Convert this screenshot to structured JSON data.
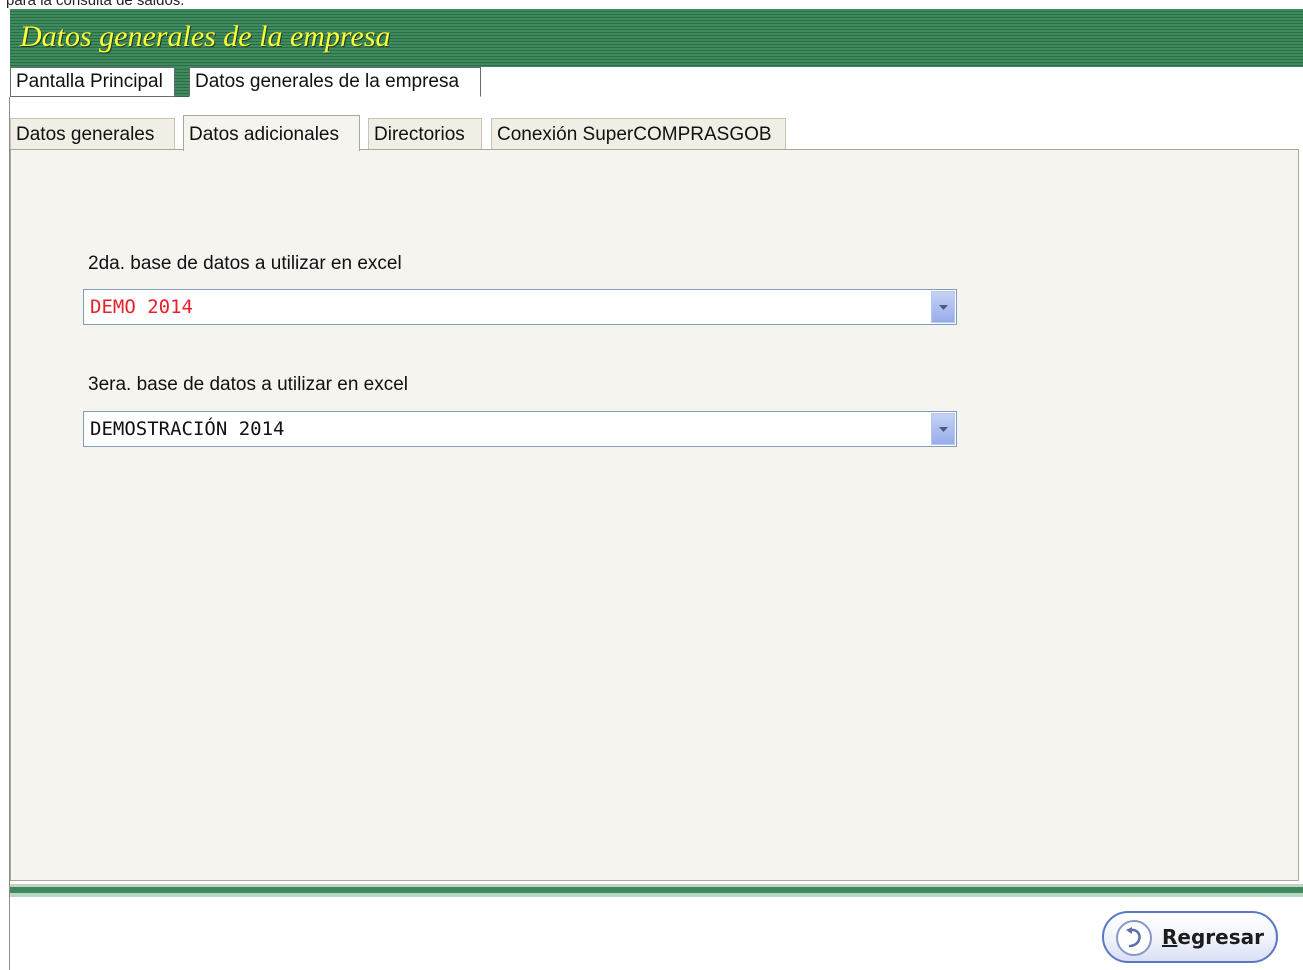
{
  "cut_text": "para la consulta de saldos.",
  "window": {
    "title": "Datos generales de la empresa"
  },
  "main_tabs": [
    {
      "label": "Pantalla Principal"
    },
    {
      "label": "Datos generales de la empresa"
    }
  ],
  "sub_tabs": [
    {
      "label": "Datos generales"
    },
    {
      "label": "Datos adicionales"
    },
    {
      "label": "Directorios"
    },
    {
      "label": "Conexión SuperCOMPRASGOB"
    }
  ],
  "fields": [
    {
      "label": "2da. base de datos a utilizar en excel",
      "value": "DEMO 2014",
      "value_color": "#e8202a"
    },
    {
      "label": "3era. base de datos a utilizar en excel",
      "value": "DEMOSTRACIÓN 2014",
      "value_color": "#111111"
    }
  ],
  "buttons": {
    "back_accel": "R",
    "back_rest": "egresar",
    "back_icon": "undo-arrow-icon"
  },
  "colors": {
    "title_text": "#ffff3a",
    "title_bar": "#3f8a5f",
    "panel_bg": "#f5f4ee"
  }
}
